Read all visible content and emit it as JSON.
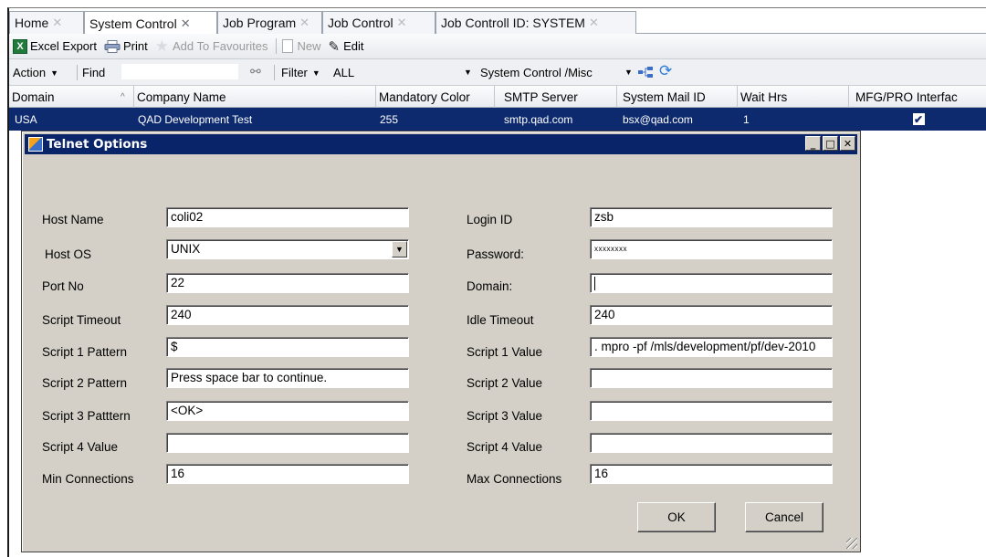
{
  "tabs": [
    {
      "label": "Home"
    },
    {
      "label": "System Control"
    },
    {
      "label": "Job Program"
    },
    {
      "label": "Job Control"
    },
    {
      "label": "Job Controll ID: SYSTEM"
    }
  ],
  "toolbar": {
    "excel_label": "Excel Export",
    "print_label": "Print",
    "favourites_label": "Add To Favourites",
    "new_label": "New",
    "edit_label": "Edit"
  },
  "filterbar": {
    "action_label": "Action",
    "find_label": "Find",
    "filter_label": "Filter",
    "filter_value": "ALL",
    "view_value": "System Control /Misc"
  },
  "grid": {
    "columns": [
      "Domain",
      "Company Name",
      "Mandatory Color",
      "SMTP Server",
      "System Mail ID",
      "Wait Hrs",
      "MFG/PRO Interfac"
    ],
    "rows": [
      {
        "domain": "USA",
        "company": "QAD Development Test",
        "color": "255",
        "smtp": "smtp.qad.com",
        "mail": "bsx@qad.com",
        "wait": "1",
        "mfg_checked": true
      }
    ]
  },
  "dialog": {
    "title": "Telnet Options",
    "left_fields": [
      {
        "label": "Host Name",
        "value": "coli02"
      },
      {
        "label": "Host OS",
        "value": "UNIX"
      },
      {
        "label": "Port No",
        "value": "22"
      },
      {
        "label": "Script Timeout",
        "value": "240"
      },
      {
        "label": "Script 1 Pattern",
        "value": "$"
      },
      {
        "label": "Script 2 Pattern",
        "value": "Press space bar to continue."
      },
      {
        "label": "Script 3 Patttern",
        "value": "<OK>"
      },
      {
        "label": "Script 4 Value",
        "value": ""
      },
      {
        "label": "Min Connections",
        "value": "16"
      }
    ],
    "right_fields": [
      {
        "label": "Login ID",
        "value": "zsb"
      },
      {
        "label": "Password:",
        "value": "xxxxxxxx"
      },
      {
        "label": "Domain:",
        "value": ""
      },
      {
        "label": "Idle Timeout",
        "value": "240"
      },
      {
        "label": "Script 1 Value",
        "value": ". mpro -pf /mls/development/pf/dev-2010"
      },
      {
        "label": "Script 2 Value",
        "value": ""
      },
      {
        "label": "Script 3 Value",
        "value": ""
      },
      {
        "label": "Script 4 Value",
        "value": ""
      },
      {
        "label": "Max Connections",
        "value": "16"
      }
    ],
    "ok_label": "OK",
    "cancel_label": "Cancel"
  },
  "colors": {
    "selection": "#0d2a6e",
    "dialog_title": "#0a246a",
    "dialog_face": "#d4d0c8"
  }
}
